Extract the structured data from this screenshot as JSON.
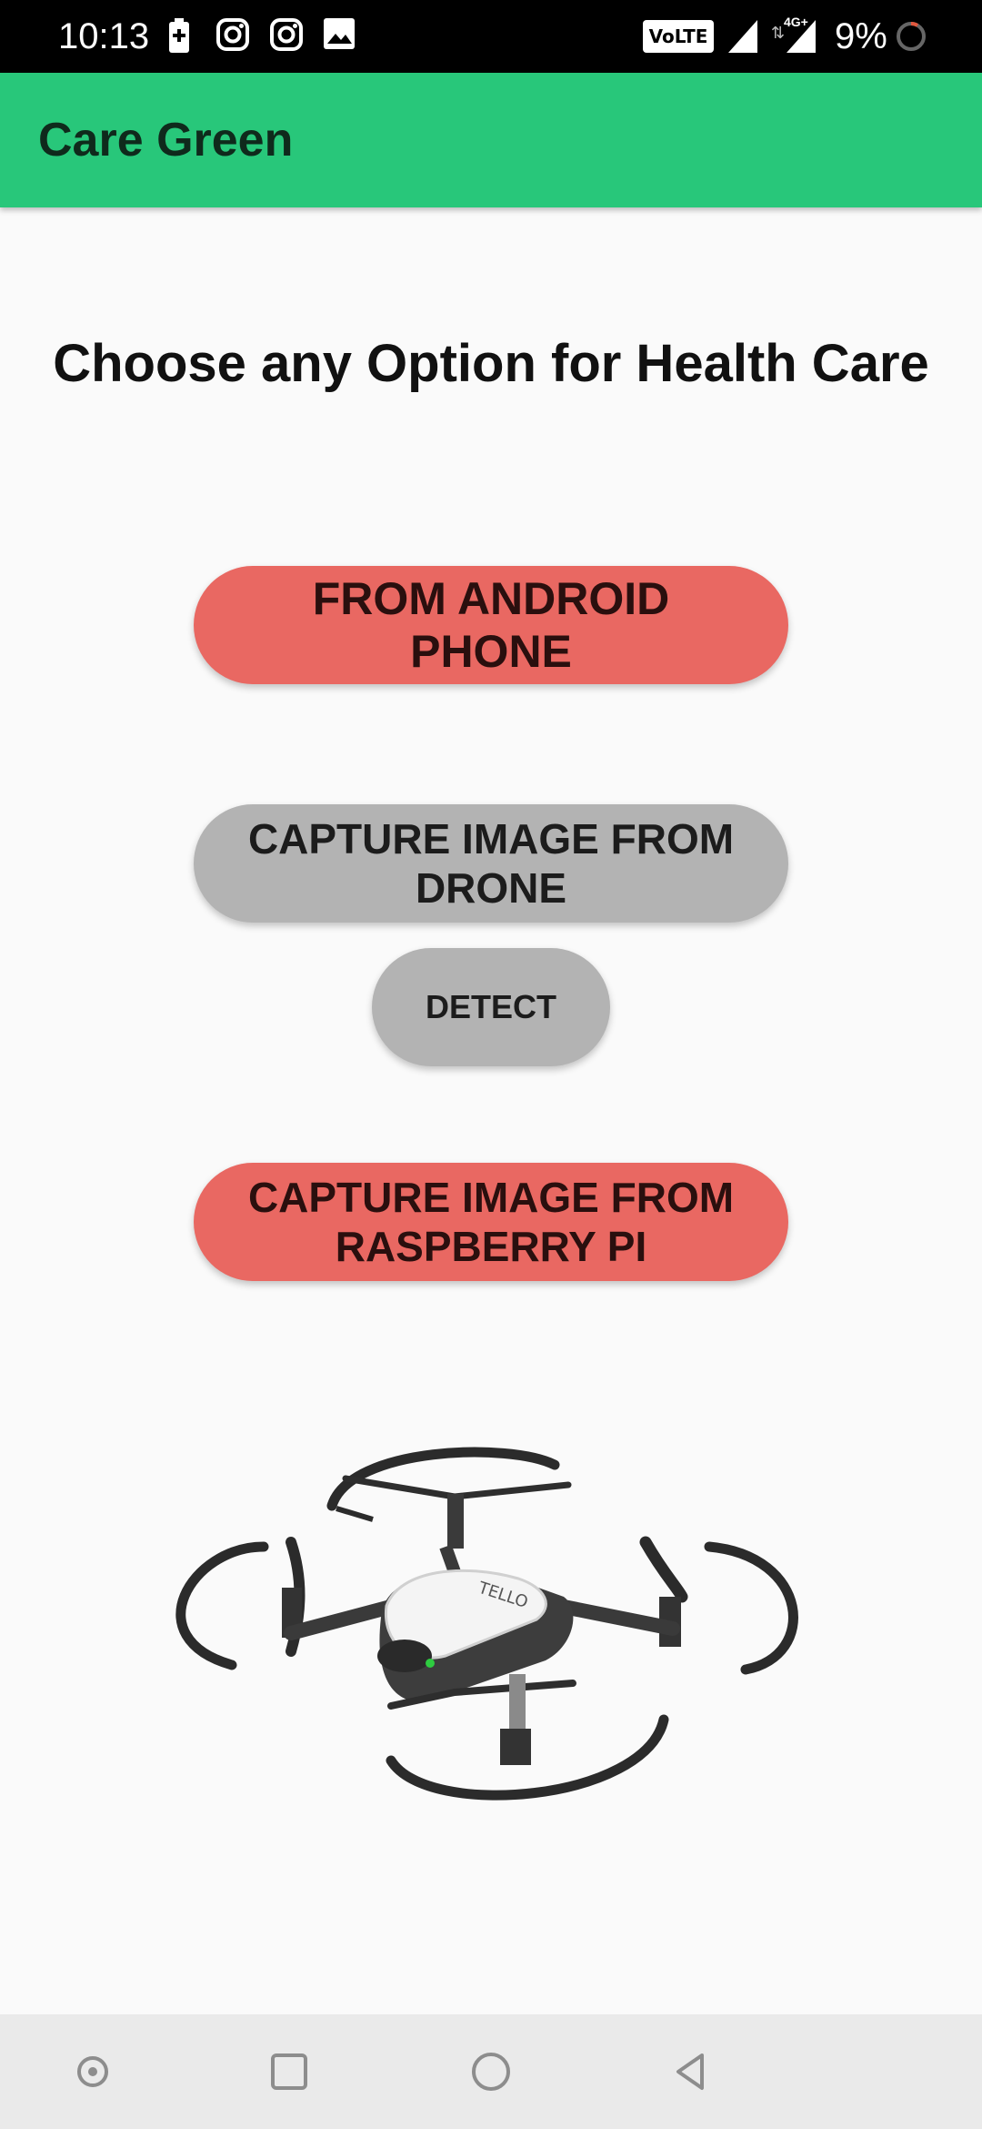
{
  "status_bar": {
    "time": "10:13",
    "volte_label": "VoLTE",
    "network_label": "4G+",
    "battery": "9%",
    "icons": [
      "battery-charging-icon",
      "instagram-icon",
      "instagram-icon",
      "image-icon",
      "signal-icon",
      "signal-4g-icon",
      "battery-ring-icon"
    ]
  },
  "app_bar": {
    "title": "Care Green",
    "color": "#28c77a"
  },
  "main": {
    "heading": "Choose any Option for Health Care",
    "buttons": {
      "android": "FROM ANDROID PHONE",
      "drone": "CAPTURE IMAGE FROM DRONE",
      "detect": "DETECT",
      "raspberry": "CAPTURE IMAGE FROM RASPBERRY PI"
    },
    "button_colors": {
      "primary": "#e96862",
      "secondary": "#b3b3b3"
    },
    "image": "drone-image"
  },
  "nav_bar": {
    "icons": [
      "screenshot-dot-icon",
      "recents-square-icon",
      "home-circle-icon",
      "back-triangle-icon"
    ]
  }
}
